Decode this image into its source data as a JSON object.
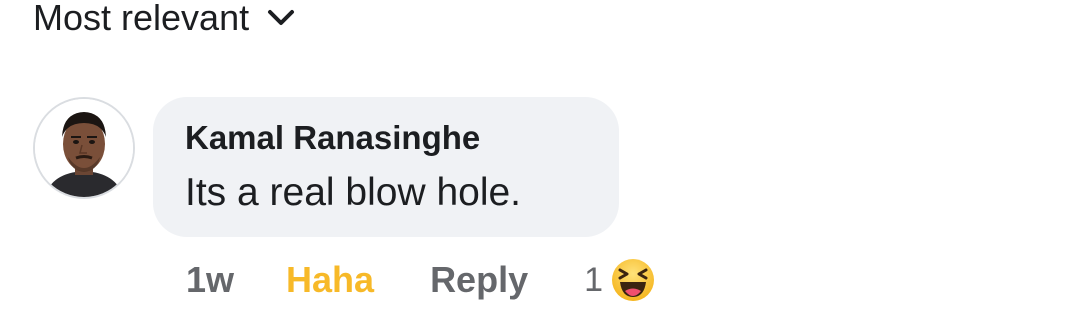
{
  "sort": {
    "label": "Most relevant",
    "icon": "chevron-down-icon"
  },
  "comment": {
    "author": "Kamal Ranasinghe",
    "text": "Its a real blow hole.",
    "avatar_icon": "user-avatar",
    "time": "1w",
    "reaction_label": "Haha",
    "reply_label": "Reply",
    "reaction_count": "1",
    "reaction_icon": "haha-emoji-icon"
  },
  "colors": {
    "haha": "#f7b928",
    "bubble": "#f0f2f5",
    "secondary_text": "#65676b",
    "primary_text": "#1c1e21"
  }
}
